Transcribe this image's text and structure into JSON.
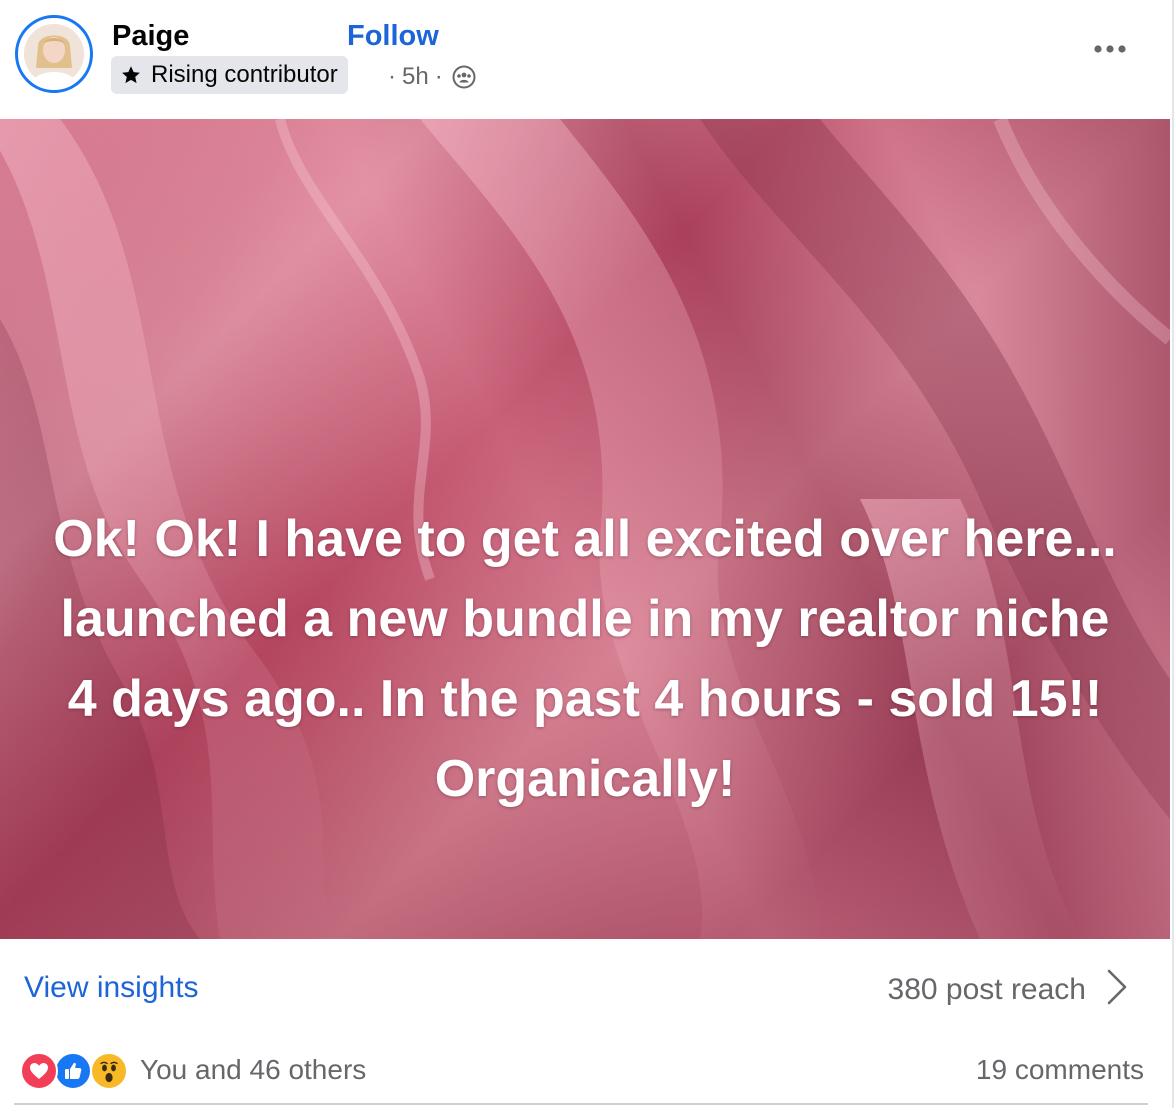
{
  "post": {
    "author_name": "Paige",
    "follow_label": "Follow",
    "badge_label": "Rising contributor",
    "meta_time": "5h",
    "meta_separator": "·",
    "audience_icon": "group-audience-icon",
    "more_icon": "more-options-icon",
    "body_text": "Ok! Ok! I have to get all excited over here... launched a new bundle in my realtor niche 4 days ago.. In the past 4 hours - sold 15!! Organically!"
  },
  "insights": {
    "view_label": "View insights",
    "reach_text": "380 post reach",
    "chevron_icon": "chevron-right-icon"
  },
  "reactions": {
    "icons": [
      "love-icon",
      "like-icon",
      "wow-icon"
    ],
    "summary_text": "You and 46 others",
    "comments_text": "19 comments"
  },
  "colors": {
    "accent_blue": "#1d64d6",
    "ring_blue": "#1877f2",
    "secondary_text": "#65676b",
    "badge_bg": "#e4e6eb",
    "love_red": "#f33e58",
    "like_blue": "#1877f2",
    "wow_yellow": "#f7b928",
    "media_pink": "#c4566f"
  }
}
